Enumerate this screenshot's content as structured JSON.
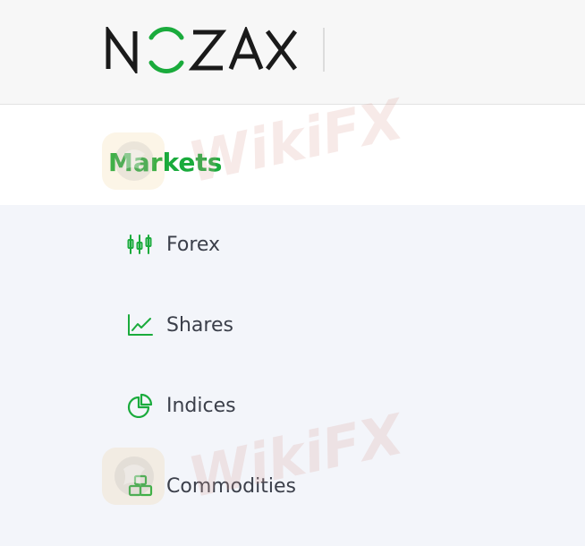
{
  "brand": {
    "logo_text": "NOZAX",
    "accent": "#1aab3c",
    "text_dark": "#1a1a1a"
  },
  "markets": {
    "title": "Markets",
    "items": [
      {
        "label": "Forex",
        "icon": "candlestick-icon"
      },
      {
        "label": "Shares",
        "icon": "line-chart-icon"
      },
      {
        "label": "Indices",
        "icon": "pie-chart-icon"
      },
      {
        "label": "Commodities",
        "icon": "gold-bars-icon"
      }
    ]
  },
  "watermark": {
    "text": "WikiFX"
  }
}
